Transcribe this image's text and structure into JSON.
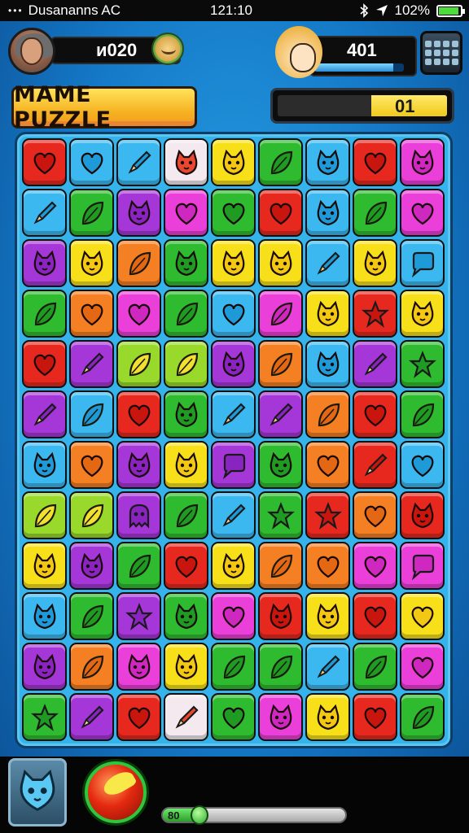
{
  "status_bar": {
    "signal": "•••",
    "carrier": "Dusananns  AC",
    "time": "121:10",
    "battery": "102%"
  },
  "player_left": {
    "name": "ᴎ020"
  },
  "player_right": {
    "score": "401",
    "score_meter": 0.88
  },
  "title": "MAME PUZZLE",
  "level": {
    "value": "01",
    "fill": 0.45
  },
  "board": {
    "columns": 9,
    "rows": [
      [
        [
          "red",
          "heart"
        ],
        [
          "blue",
          "heart"
        ],
        [
          "blue",
          "pencil"
        ],
        [
          "white",
          "cat"
        ],
        [
          "yellow",
          "cat"
        ],
        [
          "green",
          "leaf"
        ],
        [
          "blue",
          "cat"
        ],
        [
          "red",
          "heart"
        ],
        [
          "pink",
          "cat"
        ]
      ],
      [
        [
          "blue",
          "pencil"
        ],
        [
          "green",
          "leaf"
        ],
        [
          "purple",
          "cat"
        ],
        [
          "pink",
          "heart"
        ],
        [
          "green",
          "heart"
        ],
        [
          "red",
          "heart"
        ],
        [
          "blue",
          "cat"
        ],
        [
          "green",
          "leaf"
        ],
        [
          "pink",
          "heart"
        ]
      ],
      [
        [
          "purple",
          "cat"
        ],
        [
          "yellow",
          "cat"
        ],
        [
          "orange",
          "leaf"
        ],
        [
          "green",
          "cat"
        ],
        [
          "yellow",
          "cat"
        ],
        [
          "yellow",
          "cat"
        ],
        [
          "blue",
          "pencil"
        ],
        [
          "yellow",
          "cat"
        ],
        [
          "blue",
          "speech"
        ]
      ],
      [
        [
          "green",
          "leaf"
        ],
        [
          "orange",
          "heart"
        ],
        [
          "pink",
          "heart"
        ],
        [
          "green",
          "leaf"
        ],
        [
          "blue",
          "heart"
        ],
        [
          "pink",
          "leaf"
        ],
        [
          "yellow",
          "cat"
        ],
        [
          "red",
          "star"
        ],
        [
          "yellow",
          "cat"
        ]
      ],
      [
        [
          "red",
          "heart"
        ],
        [
          "purple",
          "pencil"
        ],
        [
          "lime",
          "leaf"
        ],
        [
          "lime",
          "leaf"
        ],
        [
          "purple",
          "cat"
        ],
        [
          "orange",
          "leaf"
        ],
        [
          "blue",
          "cat"
        ],
        [
          "purple",
          "pencil"
        ],
        [
          "green",
          "star"
        ]
      ],
      [
        [
          "purple",
          "pencil"
        ],
        [
          "blue",
          "leaf"
        ],
        [
          "red",
          "heart"
        ],
        [
          "green",
          "cat"
        ],
        [
          "blue",
          "pencil"
        ],
        [
          "purple",
          "pencil"
        ],
        [
          "orange",
          "leaf"
        ],
        [
          "red",
          "heart"
        ],
        [
          "green",
          "leaf"
        ]
      ],
      [
        [
          "blue",
          "cat"
        ],
        [
          "orange",
          "heart"
        ],
        [
          "purple",
          "cat"
        ],
        [
          "yellow",
          "cat"
        ],
        [
          "purple",
          "speech"
        ],
        [
          "green",
          "cat"
        ],
        [
          "orange",
          "heart"
        ],
        [
          "red",
          "pencil"
        ],
        [
          "blue",
          "heart"
        ]
      ],
      [
        [
          "lime",
          "leaf"
        ],
        [
          "lime",
          "leaf"
        ],
        [
          "purple",
          "ghost"
        ],
        [
          "green",
          "leaf"
        ],
        [
          "blue",
          "pencil"
        ],
        [
          "green",
          "star"
        ],
        [
          "red",
          "star"
        ],
        [
          "orange",
          "heart"
        ],
        [
          "red",
          "cat"
        ]
      ],
      [
        [
          "yellow",
          "cat"
        ],
        [
          "purple",
          "cat"
        ],
        [
          "green",
          "leaf"
        ],
        [
          "red",
          "heart"
        ],
        [
          "yellow",
          "cat"
        ],
        [
          "orange",
          "leaf"
        ],
        [
          "orange",
          "heart"
        ],
        [
          "pink",
          "heart"
        ],
        [
          "pink",
          "speech"
        ]
      ],
      [
        [
          "blue",
          "cat"
        ],
        [
          "green",
          "leaf"
        ],
        [
          "purple",
          "star"
        ],
        [
          "green",
          "cat"
        ],
        [
          "pink",
          "heart"
        ],
        [
          "red",
          "cat"
        ],
        [
          "yellow",
          "cat"
        ],
        [
          "red",
          "heart"
        ],
        [
          "yellow",
          "heart"
        ]
      ],
      [
        [
          "purple",
          "cat"
        ],
        [
          "orange",
          "leaf"
        ],
        [
          "pink",
          "cat"
        ],
        [
          "yellow",
          "cat"
        ],
        [
          "green",
          "leaf"
        ],
        [
          "green",
          "leaf"
        ],
        [
          "blue",
          "pencil"
        ],
        [
          "green",
          "leaf"
        ],
        [
          "pink",
          "heart"
        ]
      ],
      [
        [
          "green",
          "star"
        ],
        [
          "purple",
          "pencil"
        ],
        [
          "red",
          "heart"
        ],
        [
          "white",
          "pencil"
        ],
        [
          "green",
          "heart"
        ],
        [
          "pink",
          "cat"
        ],
        [
          "yellow",
          "cat"
        ],
        [
          "red",
          "heart"
        ],
        [
          "green",
          "leaf"
        ]
      ]
    ]
  },
  "bottom": {
    "slider_label": "80",
    "slider_value": 0.2
  },
  "colors": {
    "background": "#1478c6",
    "board_frame": "#36b3ea"
  }
}
